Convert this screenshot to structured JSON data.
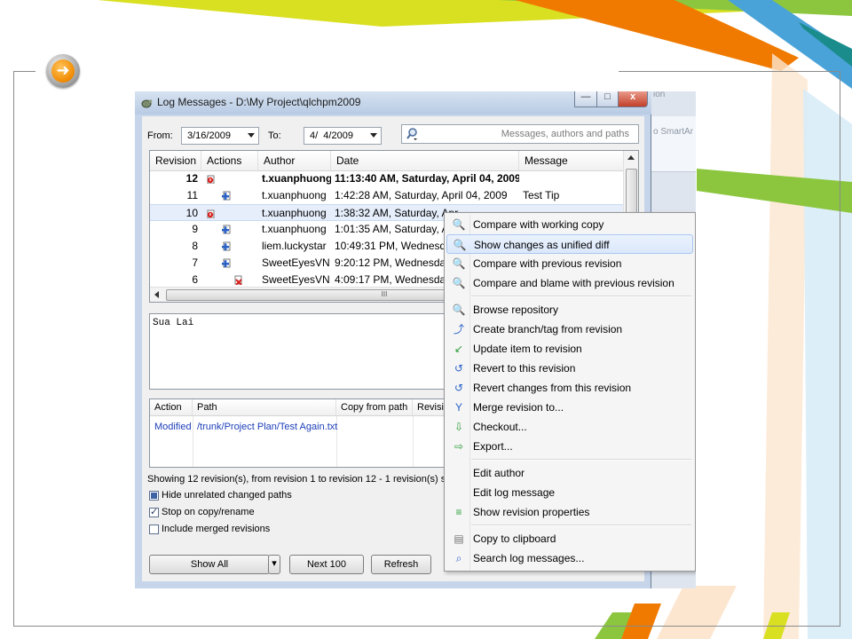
{
  "window": {
    "title": "Log Messages - D:\\My Project\\qlchpm2009",
    "minimize": "—",
    "maximize": "□",
    "close": "x"
  },
  "filters": {
    "from_label": "From:",
    "from_value": "3/16/2009",
    "to_label": "To:",
    "to_value": "4/  4/2009",
    "search_placeholder": "Messages, authors and paths"
  },
  "log_table": {
    "columns": [
      "Revision",
      "Actions",
      "Author",
      "Date",
      "Message"
    ],
    "rows": [
      {
        "revision": "12",
        "action_icon": "modified-icon",
        "author": "t.xuanphuong",
        "date": "11:13:40 AM, Saturday, April 04, 2009",
        "message": ""
      },
      {
        "revision": "11",
        "action_icon": "added-icon",
        "author": "t.xuanphuong",
        "date": "1:42:28 AM, Saturday, April 04, 2009",
        "message": "Test Tip"
      },
      {
        "revision": "10",
        "action_icon": "modified-icon",
        "author": "t.xuanphuong",
        "date": "1:38:32 AM, Saturday, Apr",
        "message": ""
      },
      {
        "revision": "9",
        "action_icon": "added-icon",
        "author": "t.xuanphuong",
        "date": "1:01:35 AM, Saturday, Apr",
        "message": ""
      },
      {
        "revision": "8",
        "action_icon": "added-icon",
        "author": "liem.luckystar",
        "date": "10:49:31 PM, Wednesday,",
        "message": ""
      },
      {
        "revision": "7",
        "action_icon": "added-icon",
        "author": "SweetEyesVN",
        "date": "9:20:12 PM, Wednesday, A",
        "message": ""
      },
      {
        "revision": "6",
        "action_icon": "deleted-icon",
        "author": "SweetEyesVN",
        "date": "4:09:17 PM, Wednesday, A",
        "message": ""
      }
    ],
    "hscroll_grip": "III"
  },
  "log_message": "Sua Lai",
  "paths_table": {
    "columns": [
      "Action",
      "Path",
      "Copy from path",
      "Revisio"
    ],
    "rows": [
      {
        "action": "Modified",
        "path": "/trunk/Project Plan/Test Again.txt",
        "copy_from": "",
        "revision": ""
      }
    ]
  },
  "status_text": "Showing 12 revision(s), from revision 1 to revision 12 - 1 revision(s) selected",
  "options": {
    "hide_unrelated": "Hide unrelated changed paths",
    "stop_on_copy": "Stop on copy/rename",
    "include_merged": "Include merged revisions"
  },
  "buttons": {
    "show_all": "Show All",
    "dropdown": "▾",
    "next_100": "Next 100",
    "refresh": "Refresh"
  },
  "context_menu": {
    "items": [
      {
        "label": "Compare with working copy",
        "icon": "compare-icon"
      },
      {
        "label": "Show changes as unified diff",
        "icon": "diff-icon"
      },
      {
        "label": "Compare with previous revision",
        "icon": "compare-previous-icon"
      },
      {
        "label": "Compare and blame with previous revision",
        "icon": "blame-icon"
      },
      {
        "label": "Browse repository",
        "icon": "browse-icon"
      },
      {
        "label": "Create branch/tag from revision",
        "icon": "branch-icon"
      },
      {
        "label": "Update item to revision",
        "icon": "update-icon"
      },
      {
        "label": "Revert to this revision",
        "icon": "revert-icon"
      },
      {
        "label": "Revert changes from this revision",
        "icon": "revert-changes-icon"
      },
      {
        "label": "Merge revision to...",
        "icon": "merge-icon"
      },
      {
        "label": "Checkout...",
        "icon": "checkout-icon"
      },
      {
        "label": "Export...",
        "icon": "export-icon"
      },
      {
        "label": "Edit author",
        "icon": ""
      },
      {
        "label": "Edit log message",
        "icon": ""
      },
      {
        "label": "Show revision properties",
        "icon": "properties-icon"
      },
      {
        "label": "Copy to clipboard",
        "icon": "clipboard-icon"
      },
      {
        "label": "Search log messages...",
        "icon": "search-icon"
      }
    ]
  },
  "background_app": {
    "text_top": "ion",
    "text_mid": "o SmartAr"
  },
  "colors": {
    "accent_orange": "#f07a00",
    "accent_green": "#8cc63f",
    "accent_teal": "#1a8c8c",
    "accent_blue": "#4aa3d8",
    "accent_yellow": "#d9e021"
  }
}
